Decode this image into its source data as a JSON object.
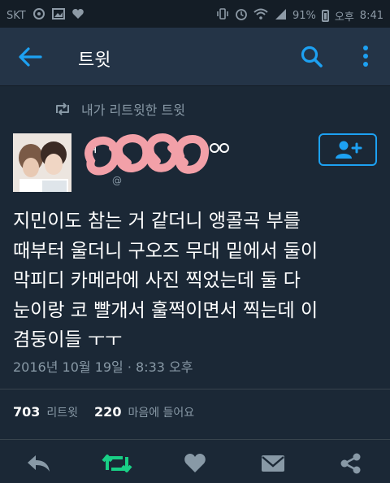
{
  "status_bar": {
    "carrier": "SKT",
    "battery": "91%",
    "time_period": "오후",
    "time": "8:41"
  },
  "app_bar": {
    "title": "트윗"
  },
  "retweet_context": {
    "text": "내가 리트윗한 트윗"
  },
  "tweet": {
    "lines": [
      "지민이도 참는 거 같더니 앵콜곡 부를",
      "때부터 울더니 구오즈 무대 밑에서 둘이",
      "막피디 카메라에 사진 찍었는데 둘 다",
      "눈이랑 코 빨개서 훌쩍이면서 찍는데 이",
      "겸둥이들 ㅜㅜ"
    ],
    "timestamp": "2016년 10월 19일 · 8:33 오후"
  },
  "stats": {
    "retweet_count": "703",
    "retweet_label": "리트윗",
    "like_count": "220",
    "like_label": "마음에 들어요"
  },
  "colors": {
    "background": "#1b2836",
    "app_bar": "#243447",
    "accent": "#1da1f2",
    "retweet_green": "#19cf86",
    "muted": "#8899a6",
    "redaction_pink": "#f2a0a8"
  },
  "icons": {
    "back": "arrow-left-icon",
    "search": "search-icon",
    "more": "more-vertical-icon",
    "retweet_context": "retweet-icon",
    "follow": "add-user-icon",
    "reply": "reply-icon",
    "retweet": "retweet-icon",
    "like": "heart-icon",
    "dm": "envelope-icon",
    "share": "share-icon"
  }
}
